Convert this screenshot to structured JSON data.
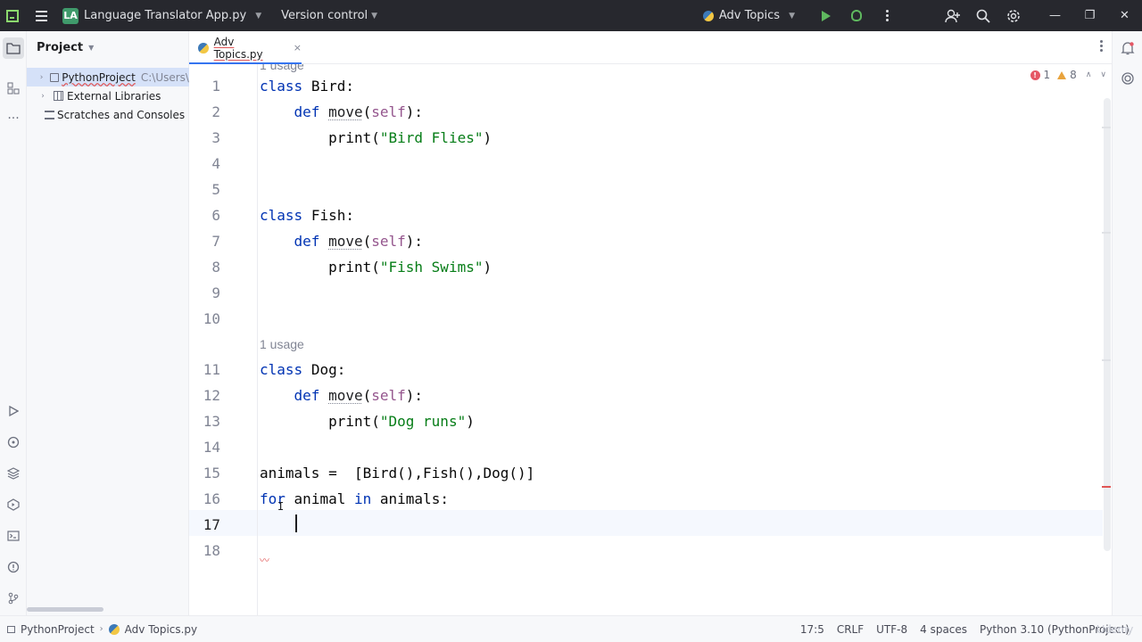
{
  "titlebar": {
    "project_badge": "LA",
    "project_name": "Language Translator App.py",
    "version_control": "Version control",
    "run_config": "Adv Topics"
  },
  "project_panel": {
    "title": "Project",
    "items": [
      {
        "label": "PythonProject",
        "path": "C:\\Users\\"
      },
      {
        "label": "External Libraries"
      },
      {
        "label": "Scratches and Consoles"
      }
    ]
  },
  "tab": {
    "label": "Adv Topics.py",
    "close": "×"
  },
  "inspections": {
    "errors": "1",
    "warnings": "8"
  },
  "code": {
    "usage_top": "1 usage",
    "usage_dog": "1 usage",
    "line_numbers": [
      "1",
      "2",
      "3",
      "4",
      "5",
      "6",
      "7",
      "8",
      "9",
      "10",
      "11",
      "12",
      "13",
      "14",
      "15",
      "16",
      "17",
      "18"
    ],
    "bird_name": "Bird",
    "bird_print": "\"Bird Flies\"",
    "fish_name": "Fish",
    "fish_print": "\"Fish Swims\"",
    "dog_name": "Dog",
    "dog_print": "\"Dog runs\"",
    "kw_class": "class",
    "kw_def": "def",
    "kw_for": "for",
    "kw_in": "in",
    "fn_move": "move",
    "self": "self",
    "fn_print": "print",
    "animals_line": "animals =  [Bird(),Fish(),Dog()]",
    "animal_var": "animal",
    "animals_var": "animals:"
  },
  "statusbar": {
    "crumb_project": "PythonProject",
    "crumb_file": "Adv Topics.py",
    "position": "17:5",
    "line_sep": "CRLF",
    "encoding": "UTF-8",
    "indent": "4 spaces",
    "interpreter": "Python 3.10 (PythonProject)"
  },
  "watermark": "Udemy",
  "colors": {
    "keyword": "#0033b3",
    "string": "#067d17",
    "self": "#94558d",
    "titlebar": "#27282e",
    "accent": "#3574f0"
  }
}
